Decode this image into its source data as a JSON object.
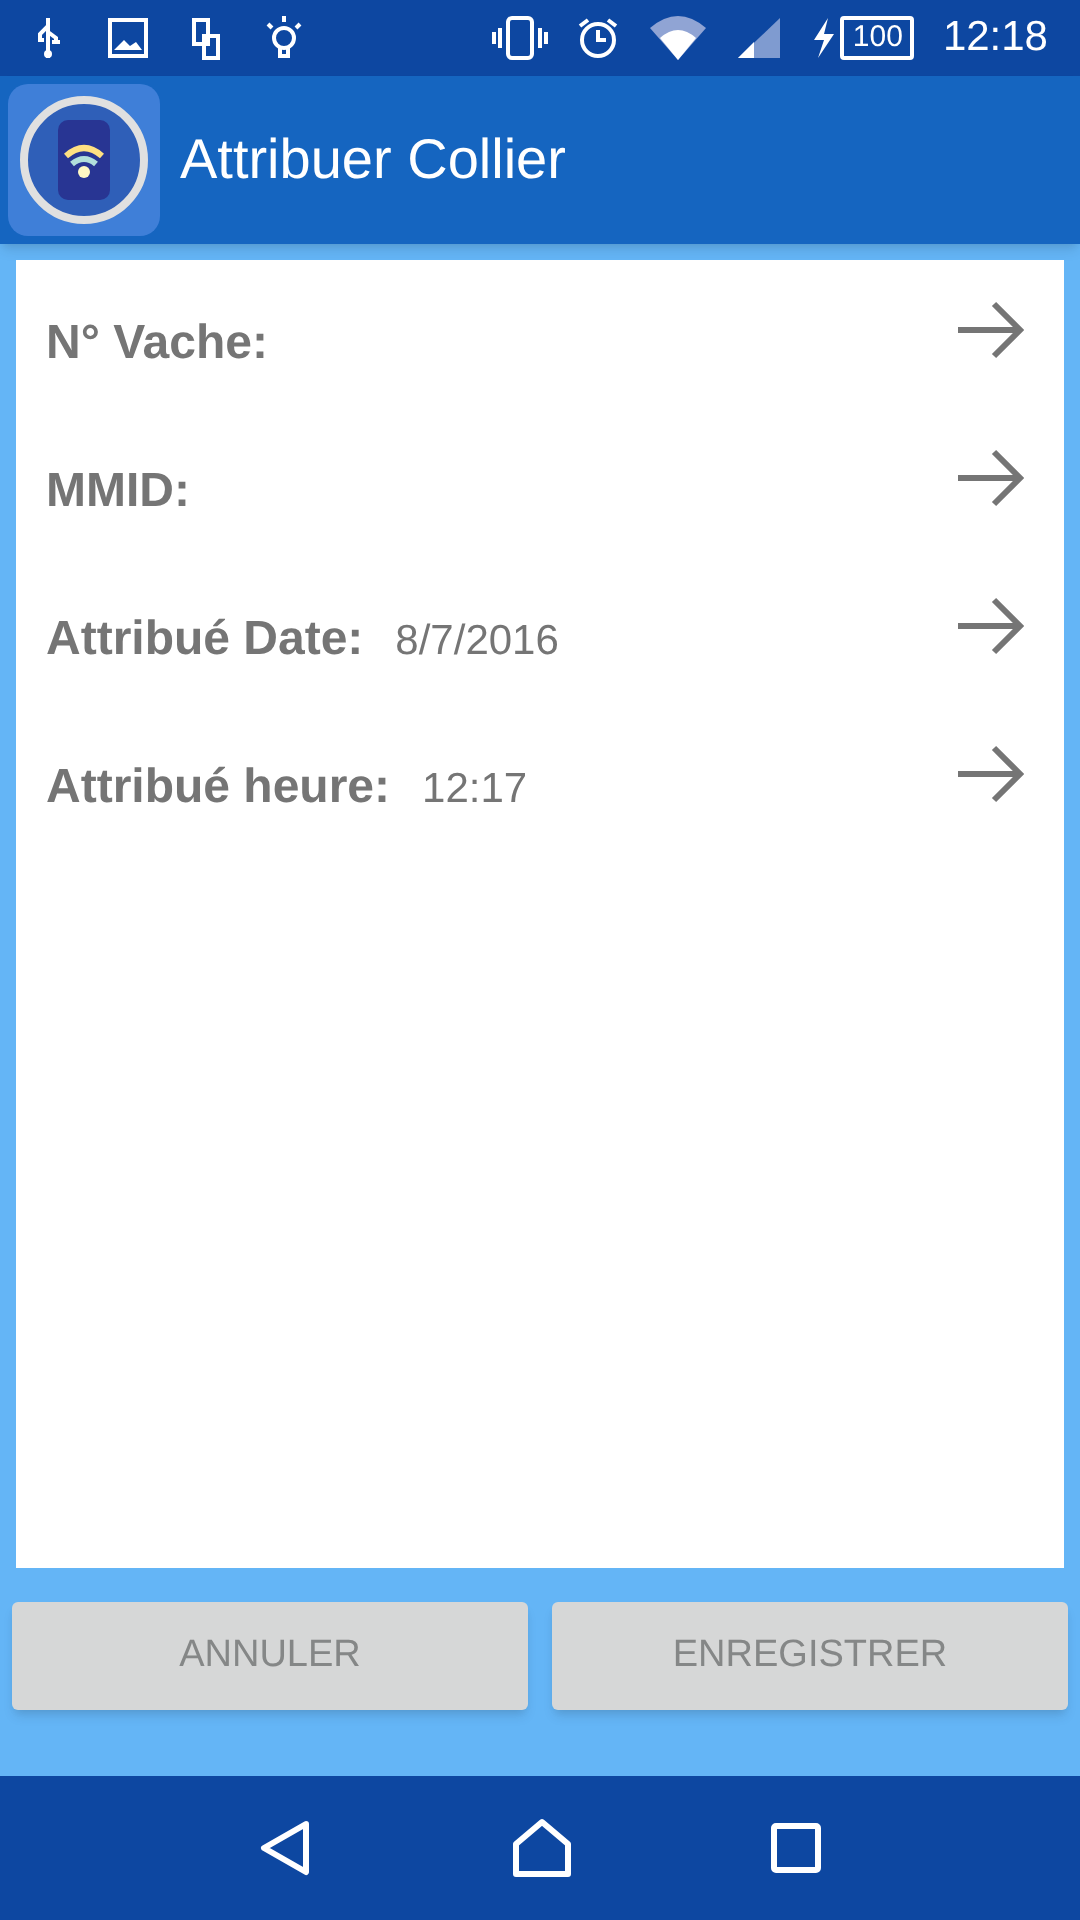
{
  "status_bar": {
    "battery": "100",
    "time": "12:18"
  },
  "app_bar": {
    "title": "Attribuer Collier"
  },
  "fields": [
    {
      "label": "N° Vache:"
    },
    {
      "label": "MMID:"
    },
    {
      "label": "Attribué Date:",
      "value": "8/7/2016"
    },
    {
      "label": "Attribué heure:",
      "value": "12:17"
    }
  ],
  "buttons": [
    {
      "label": "ANNULER",
      "disabled": true
    },
    {
      "label": "ENREGISTRER",
      "disabled": true
    }
  ]
}
